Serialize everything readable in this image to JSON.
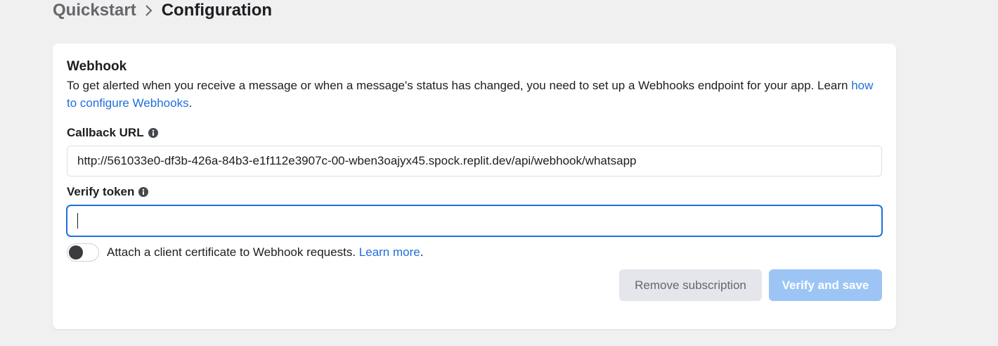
{
  "breadcrumb": {
    "parent": "Quickstart",
    "current": "Configuration"
  },
  "webhook": {
    "title": "Webhook",
    "description": "To get alerted when you receive a message or when a message's status has changed, you need to set up a Webhooks endpoint for your app. Learn ",
    "description_link": "how to configure Webhooks",
    "description_end": ".",
    "callback_url": {
      "label": "Callback URL",
      "value": "http://561033e0-df3b-426a-84b3-e1f112e3907c-00-wben3oajyx45.spock.replit.dev/api/webhook/whatsapp"
    },
    "verify_token": {
      "label": "Verify token",
      "value": ""
    },
    "certificate": {
      "text": "Attach a client certificate to Webhook requests.",
      "link": "Learn more",
      "end": ".",
      "enabled": false
    },
    "buttons": {
      "remove": "Remove subscription",
      "verify": "Verify and save"
    }
  },
  "colors": {
    "link": "#216fdb",
    "primary_disabled": "#9cc5f5",
    "secondary": "#e4e6eb"
  },
  "icons": [
    "chevron-right-icon",
    "info-icon"
  ]
}
